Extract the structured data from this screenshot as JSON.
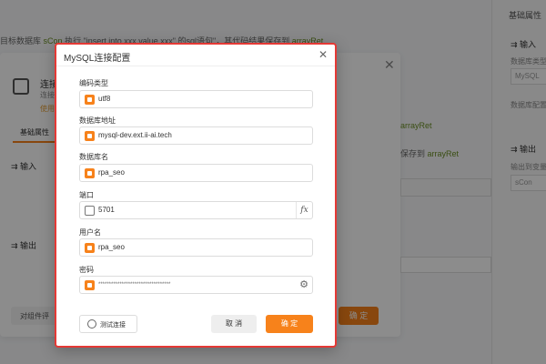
{
  "background": {
    "topline": {
      "pre": "目标数据库",
      "var1": "sCon",
      "mid": " 执行 \"insert into xxx value.xxx\" 的sql语句\"，其代码结果保存到",
      "var2": "arrayRet"
    },
    "right_panel": {
      "tab": "基础属性",
      "input_section": "输入",
      "db_type_label": "数据库类型",
      "db_type_value": "MySQL",
      "db_config_label": "数据库配置",
      "output_section": "输出",
      "output_label": "输出到变量",
      "output_value": "sCon"
    },
    "panel": {
      "title": "连接",
      "subtitle": "连接",
      "usage": "使用",
      "tab_basic": "基础属性",
      "section_input": "输入",
      "section_output": "输出",
      "btn_comment": "对组件评",
      "btn_ok": "确 定",
      "right_var": "arrayRet",
      "save_text": "保存到",
      "save_var": "arrayRet"
    }
  },
  "modal": {
    "title": "MySQL连接配置",
    "close_glyph": "✕",
    "fields": [
      {
        "label": "编码类型",
        "value": "utf8"
      },
      {
        "label": "数据库地址",
        "value": "mysql-dev.ext.ii-ai.tech"
      },
      {
        "label": "数据库名",
        "value": "rpa_seo"
      },
      {
        "label": "端口",
        "value": "5701",
        "fx": "fx"
      },
      {
        "label": "用户名",
        "value": "rpa_seo"
      },
      {
        "label": "密码",
        "value": "**********************************"
      }
    ],
    "buttons": {
      "test": "测试连接",
      "cancel": "取 消",
      "ok": "确 定"
    }
  },
  "colors": {
    "accent": "#f7821b",
    "highlight_border": "#e53935"
  }
}
